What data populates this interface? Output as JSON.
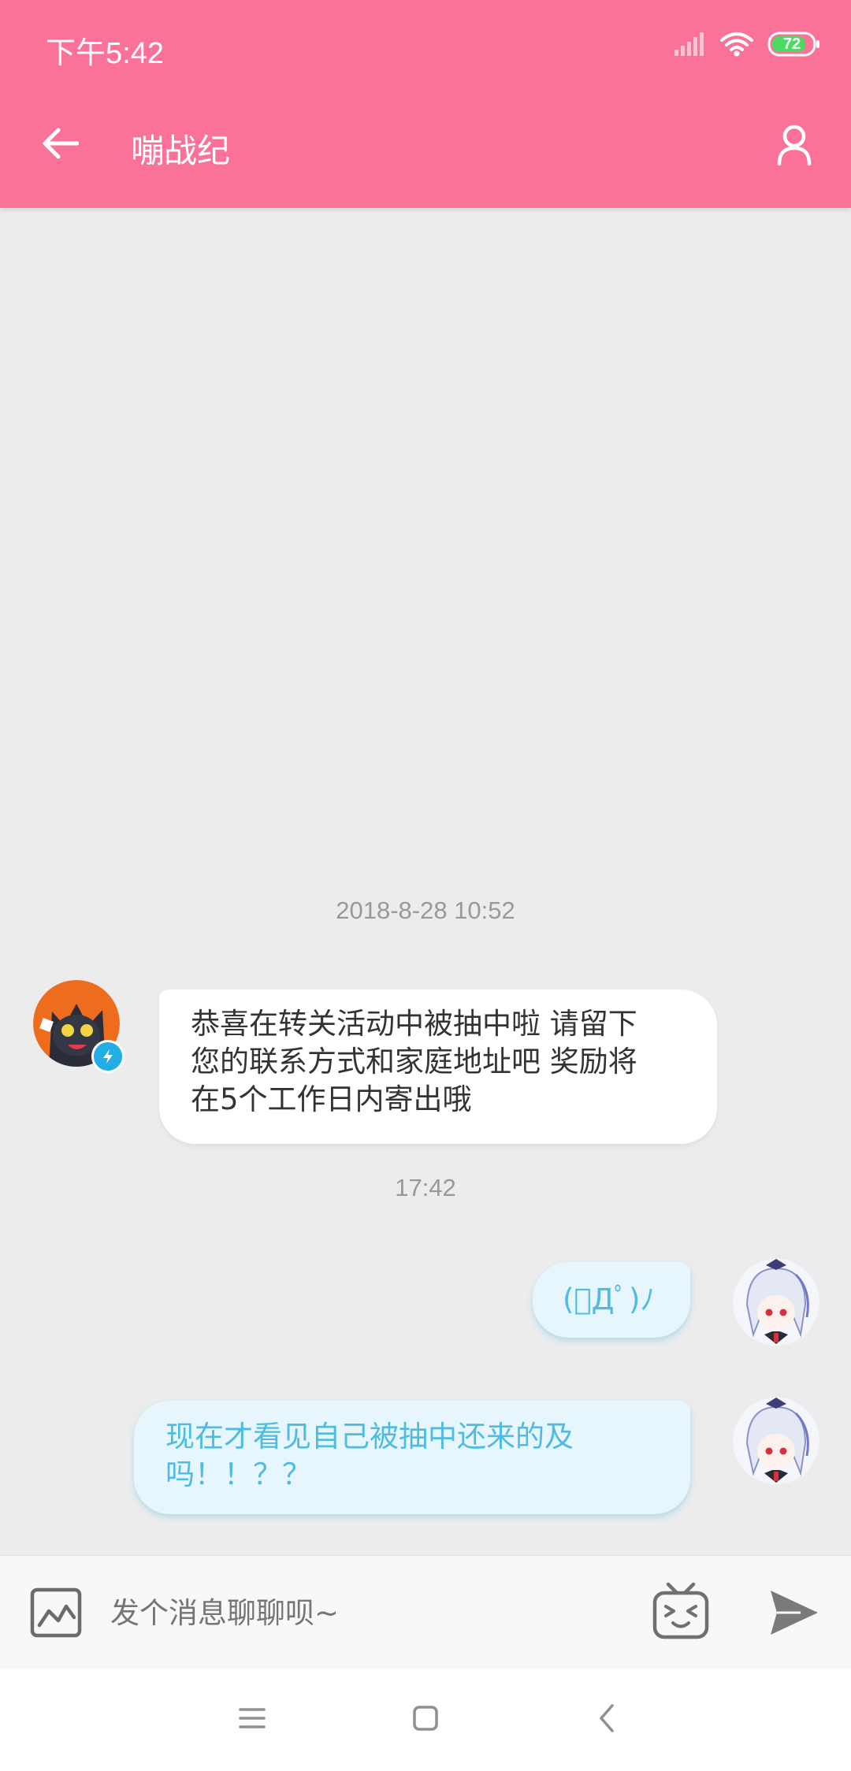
{
  "status_bar": {
    "time": "下午5:42",
    "battery": "72"
  },
  "header": {
    "title": "嘣战纪",
    "background_color": "#fb7299"
  },
  "messages": [
    {
      "type": "timestamp",
      "text": "2018-8-28 10:52"
    },
    {
      "type": "received",
      "text_lines": [
        "恭喜在转关活动中被抽中啦 请留下",
        "您的联系方式和家庭地址吧 奖励将",
        "在5个工作日内寄出哦"
      ]
    },
    {
      "type": "timestamp",
      "text": "17:42"
    },
    {
      "type": "sent",
      "text": "(ﾟДﾟ)ﾉ"
    },
    {
      "type": "sent",
      "text_lines": [
        "现在才看见自己被抽中还来的及",
        "吗！！？？"
      ]
    }
  ],
  "input_bar": {
    "placeholder": "发个消息聊聊呗~"
  },
  "icons": {
    "back": "arrow-left-icon",
    "profile": "user-icon",
    "image": "image-icon",
    "emoji": "bilibili-tv-emoji-icon",
    "send": "send-icon",
    "nav_menu": "menu-icon",
    "nav_home": "home-square-icon",
    "nav_back": "chevron-left-icon"
  },
  "colors": {
    "accent": "#fb7299",
    "sent_bubble": "#e6f6fc",
    "sent_text": "#4fbbe0",
    "badge": "#23ade5"
  }
}
